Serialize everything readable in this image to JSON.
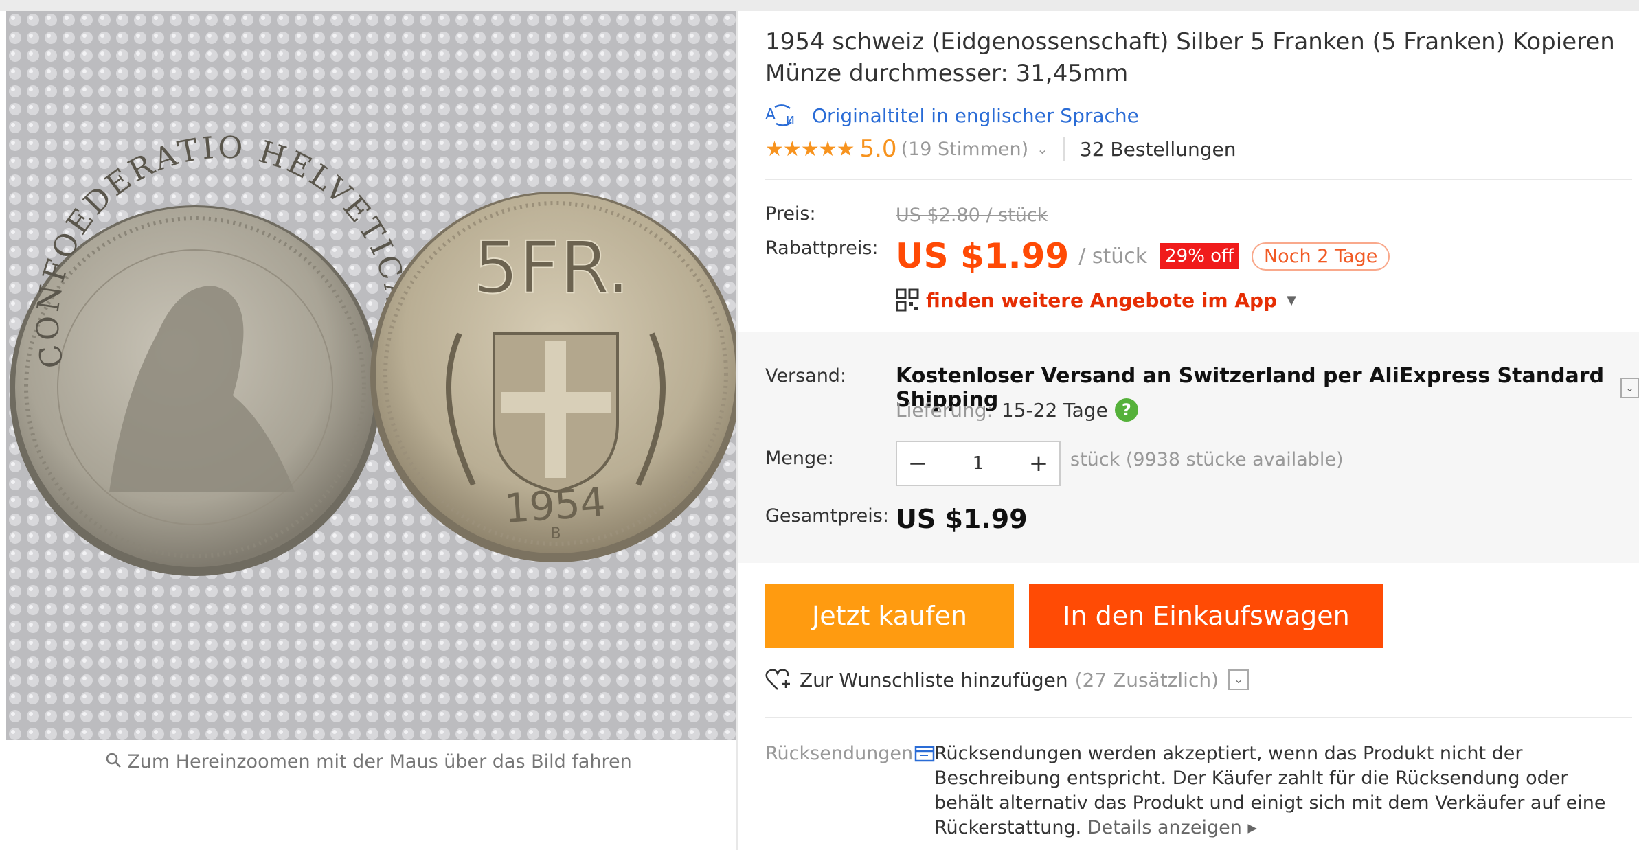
{
  "product": {
    "title": "1954 schweiz (Eidgenossenschaft) Silber 5 Franken (5 Franken) Kopieren Münze durchmesser: 31,45mm",
    "original_title_link": "Originaltitel in englischer Sprache",
    "rating_score": "5.0",
    "rating_votes": "(19 Stimmen)",
    "orders": "32 Bestellungen",
    "coin_front_text": "CONFOEDERATIO HELVETICA",
    "coin_back_value": "5FR.",
    "coin_back_year": "1954",
    "coin_back_mint": "B"
  },
  "gallery": {
    "zoom_hint": "Zum Hereinzoomen mit der Maus über das Bild fahren"
  },
  "pricing": {
    "price_label": "Preis:",
    "original_price": "US $2.80 / stück",
    "discount_label": "Rabattpreis:",
    "discount_price": "US $1.99",
    "per_unit": "/ stück",
    "discount_badge": "29% off",
    "days_left": "Noch 2 Tage",
    "app_offers": "finden weitere Angebote im App"
  },
  "shipping": {
    "label": "Versand:",
    "text": "Kostenloser Versand an Switzerland per AliExpress Standard Shipping",
    "delivery_label": "Lieferung:",
    "delivery_value": "15-22 Tage"
  },
  "quantity": {
    "label": "Menge:",
    "value": "1",
    "minus": "−",
    "plus": "+",
    "available": "stück (9938 stücke available)"
  },
  "total": {
    "label": "Gesamtpreis:",
    "value": "US $1.99"
  },
  "actions": {
    "buy_now": "Jetzt kaufen",
    "add_to_cart": "In den Einkaufswagen",
    "wishlist": "Zur Wunschliste hinzufügen",
    "wishlist_count": "(27 Zusätzlich)"
  },
  "returns": {
    "label": "Rücksendungen",
    "text": "Rücksendungen werden akzeptiert, wenn das Produkt nicht der Beschreibung entspricht. Der Käufer zahlt für die Rücksendung oder behält alternativ das Produkt und einigt sich mit dem Verkäufer auf eine Rückerstattung.",
    "details_link": "Details anzeigen"
  },
  "colors": {
    "accent_orange": "#ff4a05",
    "buy_now_bg": "#ff9b10",
    "rating_star": "#f7931e",
    "link_blue": "#2a6cd6",
    "discount_red": "#f01b1b"
  }
}
